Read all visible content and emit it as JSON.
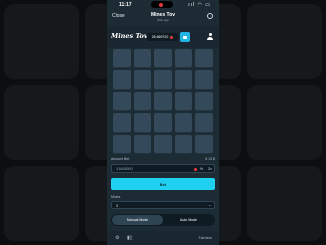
{
  "status": {
    "time": "11:17",
    "icons": "ııl ◠ ▭"
  },
  "header": {
    "close_label": "Close",
    "title": "Mines Tov",
    "subtitle": "Web app"
  },
  "topbar": {
    "logo": "Mines Tov",
    "balance": "28.669720",
    "wallet_icon": "wallet-icon",
    "profile_icon": "user-icon"
  },
  "board": {
    "rows": 5,
    "cols": 5,
    "tile_color": "#34495a"
  },
  "bet": {
    "label": "Amount Bet",
    "right_value": "0.13 $",
    "value": "3.8408000",
    "half": "½",
    "double": "2×",
    "coin_color": "#ef3b3b"
  },
  "bet_button": {
    "label": "Bet",
    "color": "#1fd0f0"
  },
  "mines": {
    "label": "Mines",
    "value": "3"
  },
  "modes": {
    "manual": "Manual Mode",
    "auto": "Auto Mode"
  },
  "bottombar": {
    "gear": "⚙",
    "chart": "▮▯",
    "fairness": "Fairness"
  },
  "colors": {
    "page_bg": "#0c0e10",
    "app_bg": "#1d2b35",
    "accent": "#1fb6e6"
  }
}
